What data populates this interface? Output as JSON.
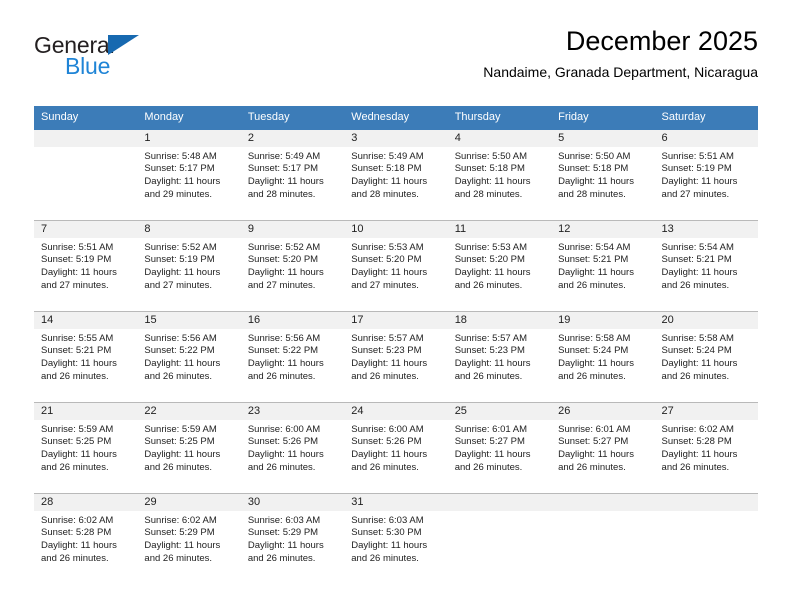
{
  "brand": {
    "name_part1": "General",
    "name_part2": "Blue",
    "triangle_color": "#1769b0",
    "blue_color": "#1f84d6"
  },
  "header": {
    "title": "December 2025",
    "subtitle": "Nandaime, Granada Department, Nicaragua"
  },
  "theme": {
    "header_row_bg": "#3c7cb8",
    "header_row_text": "#ffffff",
    "day_number_band_bg": "#f1f1f1",
    "row_divider": "#b9b9b9",
    "body_text": "#222222"
  },
  "weekdays": [
    "Sunday",
    "Monday",
    "Tuesday",
    "Wednesday",
    "Thursday",
    "Friday",
    "Saturday"
  ],
  "weeks": [
    [
      {
        "day": "",
        "sunrise": "",
        "sunset": "",
        "daylight": ""
      },
      {
        "day": "1",
        "sunrise": "Sunrise: 5:48 AM",
        "sunset": "Sunset: 5:17 PM",
        "daylight": "Daylight: 11 hours and 29 minutes."
      },
      {
        "day": "2",
        "sunrise": "Sunrise: 5:49 AM",
        "sunset": "Sunset: 5:17 PM",
        "daylight": "Daylight: 11 hours and 28 minutes."
      },
      {
        "day": "3",
        "sunrise": "Sunrise: 5:49 AM",
        "sunset": "Sunset: 5:18 PM",
        "daylight": "Daylight: 11 hours and 28 minutes."
      },
      {
        "day": "4",
        "sunrise": "Sunrise: 5:50 AM",
        "sunset": "Sunset: 5:18 PM",
        "daylight": "Daylight: 11 hours and 28 minutes."
      },
      {
        "day": "5",
        "sunrise": "Sunrise: 5:50 AM",
        "sunset": "Sunset: 5:18 PM",
        "daylight": "Daylight: 11 hours and 28 minutes."
      },
      {
        "day": "6",
        "sunrise": "Sunrise: 5:51 AM",
        "sunset": "Sunset: 5:19 PM",
        "daylight": "Daylight: 11 hours and 27 minutes."
      }
    ],
    [
      {
        "day": "7",
        "sunrise": "Sunrise: 5:51 AM",
        "sunset": "Sunset: 5:19 PM",
        "daylight": "Daylight: 11 hours and 27 minutes."
      },
      {
        "day": "8",
        "sunrise": "Sunrise: 5:52 AM",
        "sunset": "Sunset: 5:19 PM",
        "daylight": "Daylight: 11 hours and 27 minutes."
      },
      {
        "day": "9",
        "sunrise": "Sunrise: 5:52 AM",
        "sunset": "Sunset: 5:20 PM",
        "daylight": "Daylight: 11 hours and 27 minutes."
      },
      {
        "day": "10",
        "sunrise": "Sunrise: 5:53 AM",
        "sunset": "Sunset: 5:20 PM",
        "daylight": "Daylight: 11 hours and 27 minutes."
      },
      {
        "day": "11",
        "sunrise": "Sunrise: 5:53 AM",
        "sunset": "Sunset: 5:20 PM",
        "daylight": "Daylight: 11 hours and 26 minutes."
      },
      {
        "day": "12",
        "sunrise": "Sunrise: 5:54 AM",
        "sunset": "Sunset: 5:21 PM",
        "daylight": "Daylight: 11 hours and 26 minutes."
      },
      {
        "day": "13",
        "sunrise": "Sunrise: 5:54 AM",
        "sunset": "Sunset: 5:21 PM",
        "daylight": "Daylight: 11 hours and 26 minutes."
      }
    ],
    [
      {
        "day": "14",
        "sunrise": "Sunrise: 5:55 AM",
        "sunset": "Sunset: 5:21 PM",
        "daylight": "Daylight: 11 hours and 26 minutes."
      },
      {
        "day": "15",
        "sunrise": "Sunrise: 5:56 AM",
        "sunset": "Sunset: 5:22 PM",
        "daylight": "Daylight: 11 hours and 26 minutes."
      },
      {
        "day": "16",
        "sunrise": "Sunrise: 5:56 AM",
        "sunset": "Sunset: 5:22 PM",
        "daylight": "Daylight: 11 hours and 26 minutes."
      },
      {
        "day": "17",
        "sunrise": "Sunrise: 5:57 AM",
        "sunset": "Sunset: 5:23 PM",
        "daylight": "Daylight: 11 hours and 26 minutes."
      },
      {
        "day": "18",
        "sunrise": "Sunrise: 5:57 AM",
        "sunset": "Sunset: 5:23 PM",
        "daylight": "Daylight: 11 hours and 26 minutes."
      },
      {
        "day": "19",
        "sunrise": "Sunrise: 5:58 AM",
        "sunset": "Sunset: 5:24 PM",
        "daylight": "Daylight: 11 hours and 26 minutes."
      },
      {
        "day": "20",
        "sunrise": "Sunrise: 5:58 AM",
        "sunset": "Sunset: 5:24 PM",
        "daylight": "Daylight: 11 hours and 26 minutes."
      }
    ],
    [
      {
        "day": "21",
        "sunrise": "Sunrise: 5:59 AM",
        "sunset": "Sunset: 5:25 PM",
        "daylight": "Daylight: 11 hours and 26 minutes."
      },
      {
        "day": "22",
        "sunrise": "Sunrise: 5:59 AM",
        "sunset": "Sunset: 5:25 PM",
        "daylight": "Daylight: 11 hours and 26 minutes."
      },
      {
        "day": "23",
        "sunrise": "Sunrise: 6:00 AM",
        "sunset": "Sunset: 5:26 PM",
        "daylight": "Daylight: 11 hours and 26 minutes."
      },
      {
        "day": "24",
        "sunrise": "Sunrise: 6:00 AM",
        "sunset": "Sunset: 5:26 PM",
        "daylight": "Daylight: 11 hours and 26 minutes."
      },
      {
        "day": "25",
        "sunrise": "Sunrise: 6:01 AM",
        "sunset": "Sunset: 5:27 PM",
        "daylight": "Daylight: 11 hours and 26 minutes."
      },
      {
        "day": "26",
        "sunrise": "Sunrise: 6:01 AM",
        "sunset": "Sunset: 5:27 PM",
        "daylight": "Daylight: 11 hours and 26 minutes."
      },
      {
        "day": "27",
        "sunrise": "Sunrise: 6:02 AM",
        "sunset": "Sunset: 5:28 PM",
        "daylight": "Daylight: 11 hours and 26 minutes."
      }
    ],
    [
      {
        "day": "28",
        "sunrise": "Sunrise: 6:02 AM",
        "sunset": "Sunset: 5:28 PM",
        "daylight": "Daylight: 11 hours and 26 minutes."
      },
      {
        "day": "29",
        "sunrise": "Sunrise: 6:02 AM",
        "sunset": "Sunset: 5:29 PM",
        "daylight": "Daylight: 11 hours and 26 minutes."
      },
      {
        "day": "30",
        "sunrise": "Sunrise: 6:03 AM",
        "sunset": "Sunset: 5:29 PM",
        "daylight": "Daylight: 11 hours and 26 minutes."
      },
      {
        "day": "31",
        "sunrise": "Sunrise: 6:03 AM",
        "sunset": "Sunset: 5:30 PM",
        "daylight": "Daylight: 11 hours and 26 minutes."
      },
      {
        "day": "",
        "sunrise": "",
        "sunset": "",
        "daylight": ""
      },
      {
        "day": "",
        "sunrise": "",
        "sunset": "",
        "daylight": ""
      },
      {
        "day": "",
        "sunrise": "",
        "sunset": "",
        "daylight": ""
      }
    ]
  ]
}
